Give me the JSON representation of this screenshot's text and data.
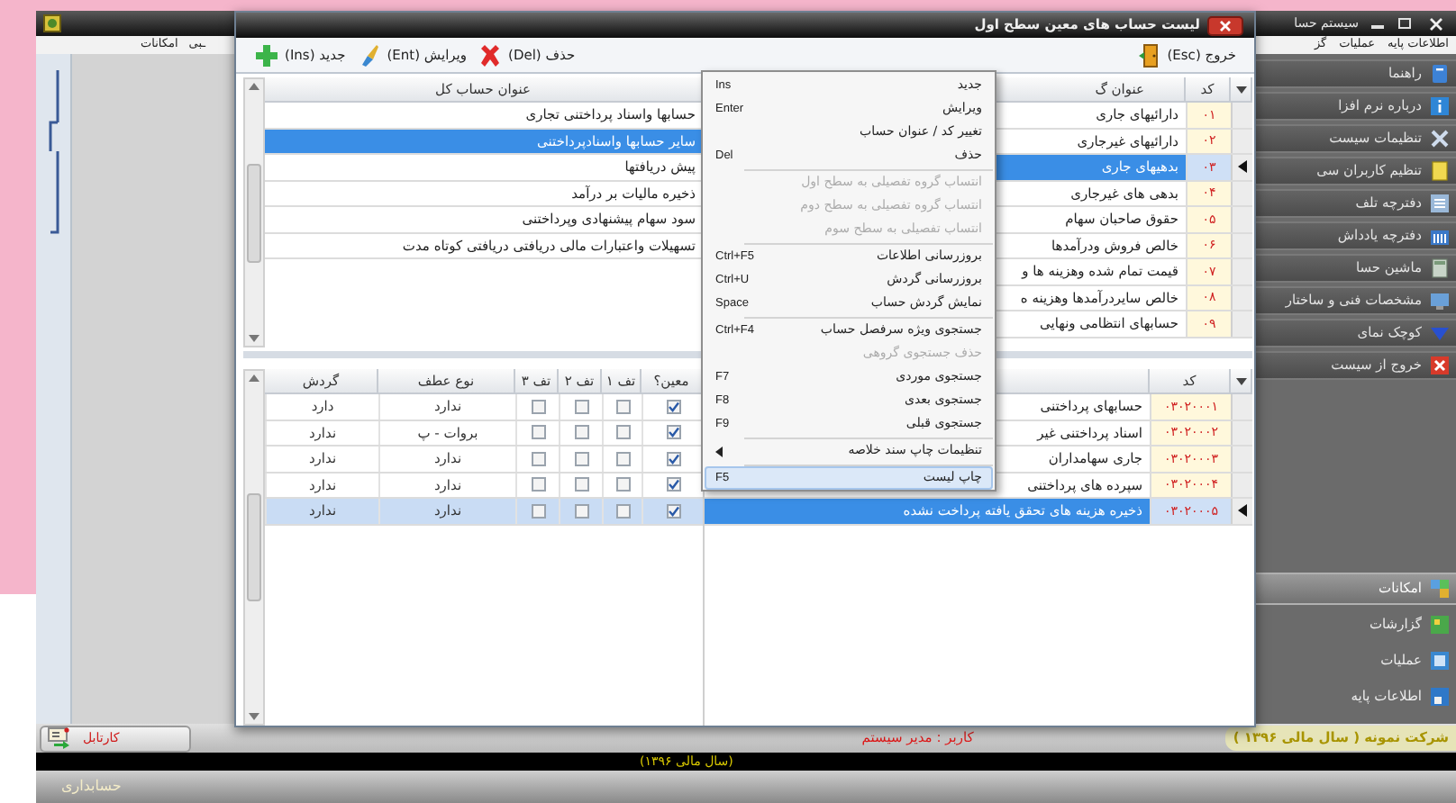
{
  "app_window": {
    "title": "سیستم حسا"
  },
  "menu_bar": {
    "items_left": [
      "ـبی",
      "امکانات"
    ],
    "items_right": [
      "اطلاعات پایه",
      "عملیات",
      "گز"
    ]
  },
  "sidebar": {
    "buttons": [
      {
        "label": "راهنما"
      },
      {
        "label": "درباره نرم افزا"
      },
      {
        "label": "تنظیمات سیست"
      },
      {
        "label": "تنظیم کاربران سی"
      },
      {
        "label": "دفترچه تلف"
      },
      {
        "label": "دفترچه یادداش"
      },
      {
        "label": "ماشین حسا"
      },
      {
        "label": "مشخصات فنی و ساختار"
      },
      {
        "label": "کوچک نمای"
      },
      {
        "label": "خروج از سیست"
      }
    ],
    "sections": [
      {
        "label": "امکانات",
        "selected": true
      },
      {
        "label": "گزارشات",
        "selected": false
      },
      {
        "label": "عملیات",
        "selected": false
      },
      {
        "label": "اطلاعات پایه",
        "selected": false
      }
    ]
  },
  "dialog": {
    "title": "لیست حساب های معین سطح اول",
    "toolbar": {
      "actions": [
        {
          "label": "حذف (Del)"
        },
        {
          "label": "ویرایش (Ent)"
        },
        {
          "label": "جدید (Ins)"
        }
      ],
      "exit": "خروج (Esc)"
    },
    "general_accounts": {
      "header": "عنوان حساب کل",
      "rows": [
        {
          "title": "حسابها واسناد پرداختنی تجاری",
          "selected": false
        },
        {
          "title": "سایر حسابها واسنادپرداختنی",
          "selected": true
        },
        {
          "title": "پیش دریافتها",
          "selected": false
        },
        {
          "title": "ذخیره مالیات بر درآمد",
          "selected": false
        },
        {
          "title": "سود سهام پیشنهادی وپرداختنی",
          "selected": false
        },
        {
          "title": "تسهیلات واعتبارات مالی دریافتی دریافتی کوتاه مدت",
          "selected": false
        }
      ]
    },
    "groups": {
      "columns": {
        "code": "کد",
        "title": "عنوان گ"
      },
      "rows": [
        {
          "code": "۰۱",
          "title": "دارائیهای جاری",
          "selected": false
        },
        {
          "code": "۰۲",
          "title": "دارائیهای غیرجاری",
          "selected": false
        },
        {
          "code": "۰۳",
          "title": "بدهیهای جاری",
          "selected": true
        },
        {
          "code": "۰۴",
          "title": "بدهی های غیرجاری",
          "selected": false
        },
        {
          "code": "۰۵",
          "title": "حقوق صاحبان سهام",
          "selected": false
        },
        {
          "code": "۰۶",
          "title": "خالص فروش ودرآمدها",
          "selected": false
        },
        {
          "code": "۰۷",
          "title": "قیمت تمام شده وهزینه ها و",
          "selected": false
        },
        {
          "code": "۰۸",
          "title": "خالص سایردرآمدها وهزینه ه",
          "selected": false
        },
        {
          "code": "۰۹",
          "title": "حسابهای انتظامی ونهایی",
          "selected": false
        }
      ]
    },
    "subsidiary_details": {
      "columns": [
        "معین؟",
        "تف ۱",
        "تف ۲",
        "تف ۳",
        "نوع عطف",
        "گردش"
      ],
      "rows": [
        {
          "selected": false,
          "cells": [
            {
              "kind": "check",
              "checked": true
            },
            {
              "kind": "check",
              "checked": false
            },
            {
              "kind": "check",
              "checked": false
            },
            {
              "kind": "check",
              "checked": false
            },
            {
              "kind": "text",
              "text": "ندارد"
            },
            {
              "kind": "text",
              "text": "دارد"
            }
          ]
        },
        {
          "selected": false,
          "cells": [
            {
              "kind": "check",
              "checked": true
            },
            {
              "kind": "check",
              "checked": false
            },
            {
              "kind": "check",
              "checked": false
            },
            {
              "kind": "check",
              "checked": false
            },
            {
              "kind": "text",
              "text": "بروات - پ"
            },
            {
              "kind": "text",
              "text": "ندارد"
            }
          ]
        },
        {
          "selected": false,
          "cells": [
            {
              "kind": "check",
              "checked": true
            },
            {
              "kind": "check",
              "checked": false
            },
            {
              "kind": "check",
              "checked": false
            },
            {
              "kind": "check",
              "checked": false
            },
            {
              "kind": "text",
              "text": "ندارد"
            },
            {
              "kind": "text",
              "text": "ندارد"
            }
          ]
        },
        {
          "selected": false,
          "cells": [
            {
              "kind": "check",
              "checked": true
            },
            {
              "kind": "check",
              "checked": false
            },
            {
              "kind": "check",
              "checked": false
            },
            {
              "kind": "check",
              "checked": false
            },
            {
              "kind": "text",
              "text": "ندارد"
            },
            {
              "kind": "text",
              "text": "ندارد"
            }
          ]
        },
        {
          "selected": true,
          "cells": [
            {
              "kind": "check",
              "checked": true
            },
            {
              "kind": "check",
              "checked": false
            },
            {
              "kind": "check",
              "checked": false
            },
            {
              "kind": "check",
              "checked": false
            },
            {
              "kind": "text",
              "text": "ندارد"
            },
            {
              "kind": "text",
              "text": "ندارد"
            }
          ]
        }
      ]
    },
    "subsidiary_accounts": {
      "columns": {
        "code": "کد"
      },
      "rows": [
        {
          "code": "۰۳۰۲۰۰۰۱",
          "title": "حسابهای پرداختنی",
          "selected": false
        },
        {
          "code": "۰۳۰۲۰۰۰۲",
          "title": "اسناد پرداختنی غیر",
          "selected": false
        },
        {
          "code": "۰۳۰۲۰۰۰۳",
          "title": "جاری سهامداران",
          "selected": false
        },
        {
          "code": "۰۳۰۲۰۰۰۴",
          "title": "سپرده های پرداختنی",
          "selected": false
        },
        {
          "code": "۰۳۰۲۰۰۰۵",
          "title": "ذخیره هزینه های تحقق یافته پرداخت نشده",
          "selected": true
        }
      ]
    },
    "context_menu": [
      {
        "kind": "item",
        "label": "جدید",
        "shortcut": "Ins",
        "disabled": false,
        "highlighted": false
      },
      {
        "kind": "item",
        "label": "ویرایش",
        "shortcut": "Enter",
        "disabled": false,
        "highlighted": false
      },
      {
        "kind": "item",
        "label": "تغییر کد / عنوان حساب",
        "disabled": false,
        "highlighted": false
      },
      {
        "kind": "item",
        "label": "حذف",
        "shortcut": "Del",
        "disabled": false,
        "highlighted": false
      },
      {
        "kind": "separator"
      },
      {
        "kind": "item",
        "label": "انتساب گروه تفصیلی به سطح اول",
        "disabled": true,
        "highlighted": false
      },
      {
        "kind": "item",
        "label": "انتساب گروه تفصیلی به سطح دوم",
        "disabled": true,
        "highlighted": false
      },
      {
        "kind": "item",
        "label": "انتساب تفصیلی به سطح سوم",
        "disabled": true,
        "highlighted": false
      },
      {
        "kind": "separator"
      },
      {
        "kind": "item",
        "label": "بروزرسانی اطلاعات",
        "shortcut": "Ctrl+F5",
        "disabled": false,
        "highlighted": false
      },
      {
        "kind": "item",
        "label": "بروزرسانی گردش",
        "shortcut": "Ctrl+U",
        "disabled": false,
        "highlighted": false
      },
      {
        "kind": "item",
        "label": "نمایش گردش حساب",
        "shortcut": "Space",
        "disabled": false,
        "highlighted": false
      },
      {
        "kind": "separator"
      },
      {
        "kind": "item",
        "label": "جستجوی ویژه سرفصل حساب",
        "shortcut": "Ctrl+F4",
        "disabled": false,
        "highlighted": false
      },
      {
        "kind": "item",
        "label": "حذف جستجوی گروهی",
        "disabled": true,
        "highlighted": false
      },
      {
        "kind": "item",
        "label": "جستجوی موردی",
        "shortcut": "F7",
        "disabled": false,
        "highlighted": false
      },
      {
        "kind": "item",
        "label": "جستجوی بعدی",
        "shortcut": "F8",
        "disabled": false,
        "highlighted": false
      },
      {
        "kind": "item",
        "label": "جستجوی قبلی",
        "shortcut": "F9",
        "disabled": false,
        "highlighted": false
      },
      {
        "kind": "separator"
      },
      {
        "kind": "item",
        "label": "تنظیمات چاپ سند خلاصه",
        "submenu": true,
        "disabled": false,
        "highlighted": false
      },
      {
        "kind": "separator"
      },
      {
        "kind": "item",
        "label": "چاپ لیست",
        "shortcut": "F5",
        "disabled": false,
        "highlighted": true
      }
    ]
  },
  "status_bar": {
    "inbox_button": "کارتابل",
    "user": "کاربر : مدیر سیستم",
    "company": "شرکت نمونه ( سال مالی ۱۳۹۶ )",
    "fiscal_year": "(سال مالی ۱۳۹۶)"
  },
  "footer": {
    "app_name": "حسابداری"
  }
}
